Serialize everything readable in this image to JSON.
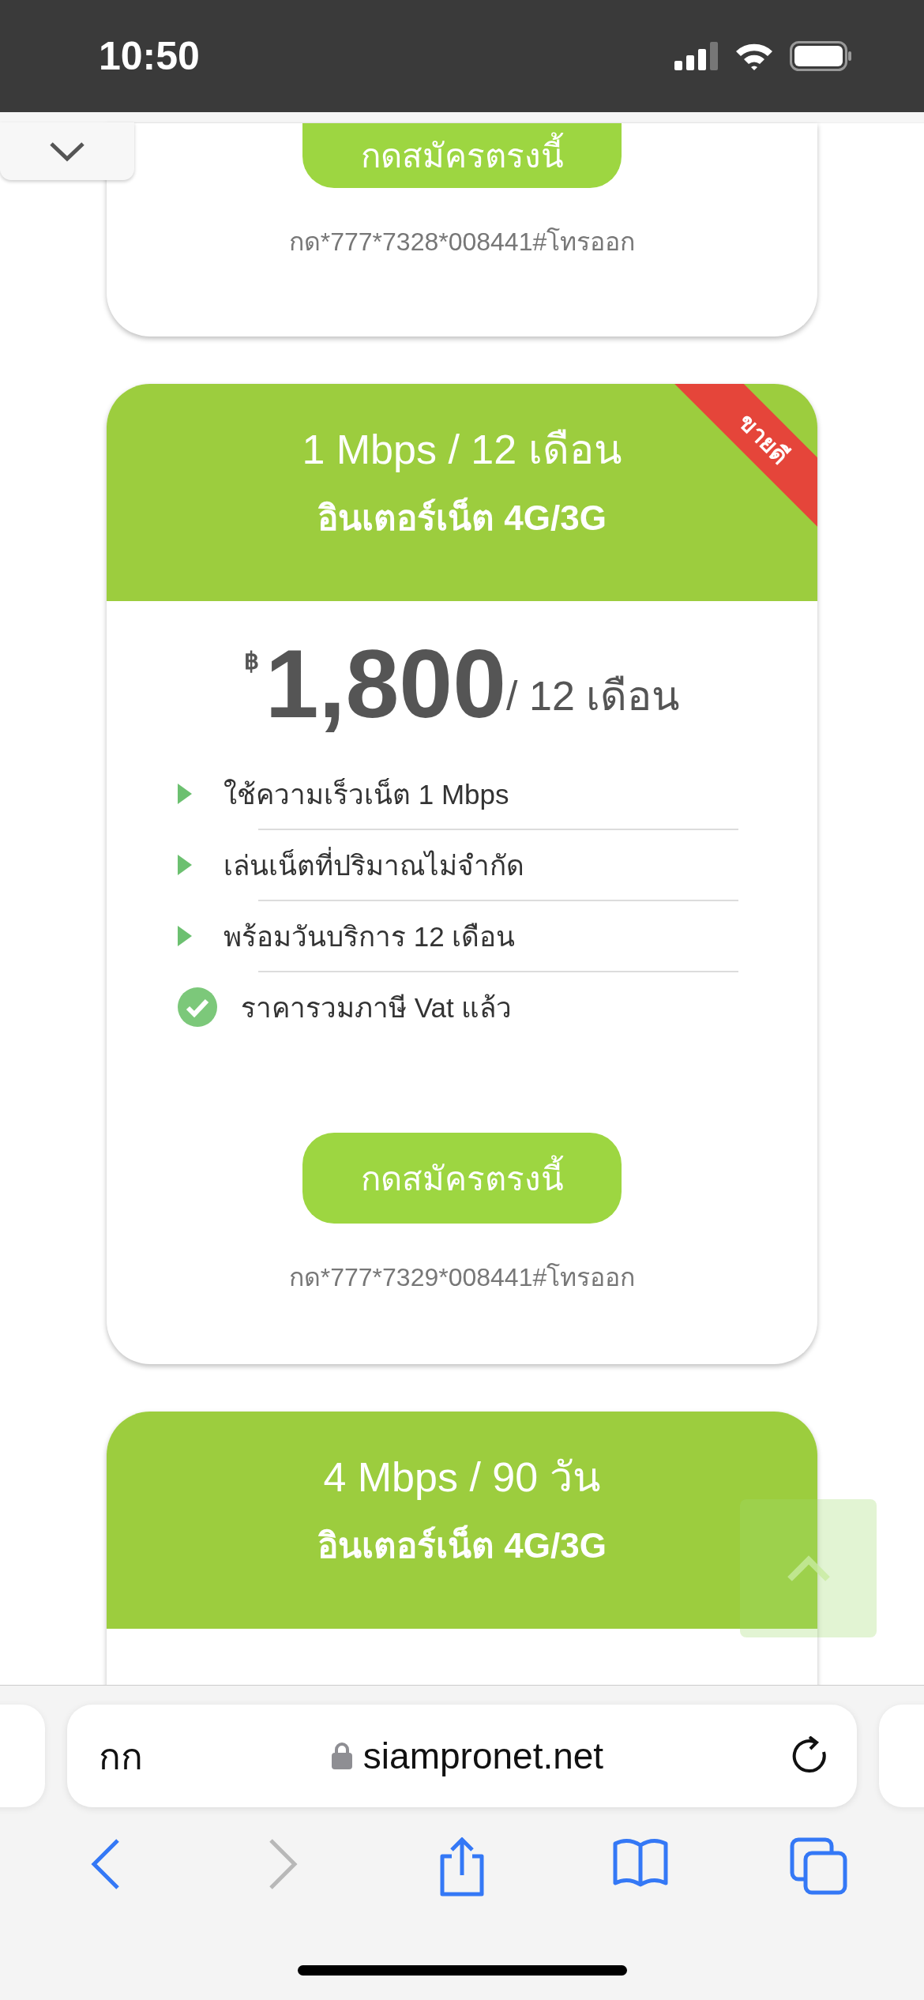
{
  "status_bar": {
    "time": "10:50"
  },
  "menu_toggle": {
    "expanded": false
  },
  "cards": [
    {
      "signup_button": "กดสมัครตรงนี้",
      "dial_code": "กด*777*7328*008441#โทรออก"
    },
    {
      "title": "1 Mbps / 12 เดือน",
      "subtitle": "อินเตอร์เน็ต 4G/3G",
      "ribbon": "ขายดี",
      "price": {
        "currency": "฿",
        "amount": "1,800",
        "period": "/ 12 เดือน"
      },
      "features": [
        {
          "kind": "arrow",
          "text": "ใช้ความเร็วเน็ต 1 Mbps"
        },
        {
          "kind": "arrow",
          "text": "เล่นเน็ตที่ปริมาณไม่จำกัด"
        },
        {
          "kind": "arrow",
          "text": "พร้อมวันบริการ 12 เดือน"
        },
        {
          "kind": "check",
          "text": "ราคารวมภาษี Vat แล้ว"
        }
      ],
      "signup_button": "กดสมัครตรงนี้",
      "dial_code": "กด*777*7329*008441#โทรออก"
    },
    {
      "title": "4 Mbps / 90 วัน",
      "subtitle": "อินเตอร์เน็ต 4G/3G"
    }
  ],
  "browser": {
    "text_size_button": "กก",
    "url": "siampronet.net",
    "toolbar": [
      {
        "kind": "back",
        "disabled": false
      },
      {
        "kind": "forward",
        "disabled": true
      },
      {
        "kind": "share",
        "disabled": false
      },
      {
        "kind": "bookmarks",
        "disabled": false
      },
      {
        "kind": "tabs",
        "disabled": false
      }
    ]
  }
}
